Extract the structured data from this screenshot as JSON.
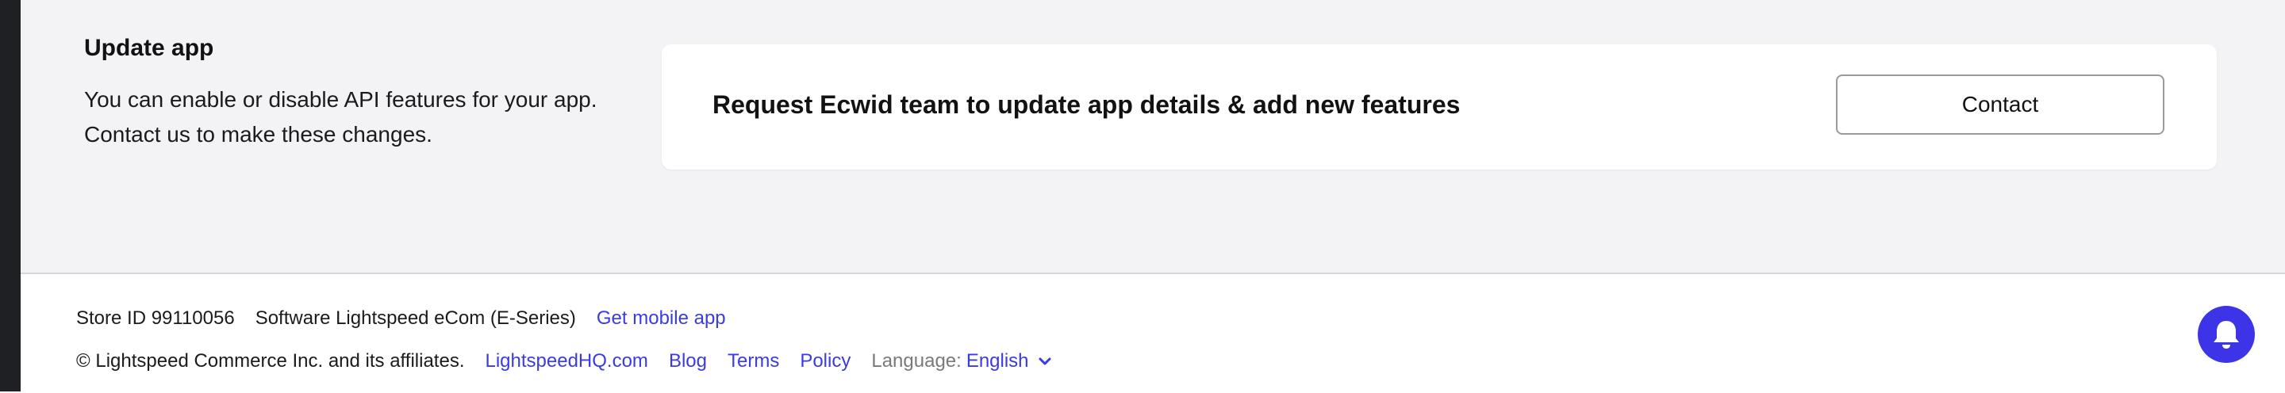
{
  "update_section": {
    "title": "Update app",
    "description_line1": "You can enable or disable API features for your app.",
    "description_line2": "Contact us to make these changes."
  },
  "request_card": {
    "text": "Request Ecwid team to update app details & add new features",
    "button_label": "Contact"
  },
  "footer": {
    "store_id": "Store ID 99110056",
    "software": "Software Lightspeed eCom (E-Series)",
    "mobile_link": "Get mobile app",
    "copyright": "© Lightspeed Commerce Inc. and its affiliates.",
    "links": [
      "LightspeedHQ.com",
      "Blog",
      "Terms",
      "Policy"
    ],
    "language_label": "Language:",
    "language_value": "English"
  },
  "icons": {
    "language_dropdown": "chevron-down-icon",
    "notifications": "bell-icon"
  },
  "colors": {
    "accent": "#3d34e8",
    "link": "#3b3be6",
    "page_background": "#f3f2f5",
    "sidebar": "#1f2023"
  }
}
